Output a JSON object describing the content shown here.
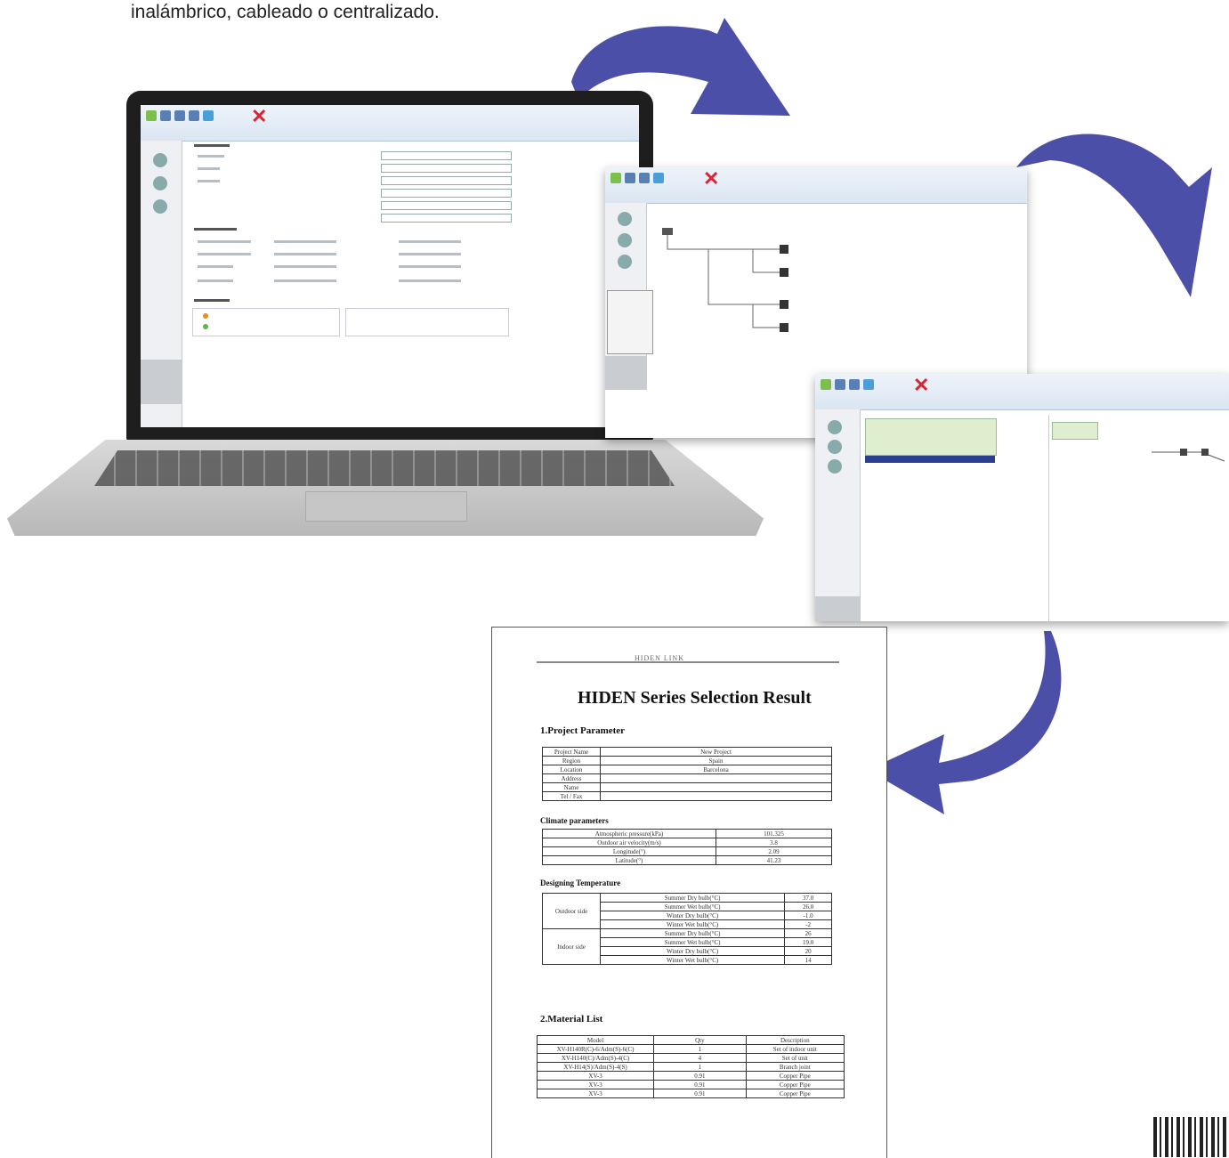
{
  "intro_text": "inalámbrico, cableado o centralizado.",
  "report": {
    "header": "HIDEN LINK",
    "title": "HIDEN Series Selection Result",
    "section1": "1.Project Parameter",
    "project_rows": [
      [
        "Project Name",
        "New Project"
      ],
      [
        "Region",
        "Spain"
      ],
      [
        "Location",
        "Barcelona"
      ],
      [
        "Address",
        ""
      ],
      [
        "Name",
        ""
      ],
      [
        "Tel / Fax",
        ""
      ]
    ],
    "climate_title": "Climate parameters",
    "climate_rows": [
      [
        "Atmospheric pressure(kPa)",
        "101.325"
      ],
      [
        "Outdoor air velocity(m/s)",
        "3.8"
      ],
      [
        "Longitude(°)",
        "2.09"
      ],
      [
        "Latitude(°)",
        "41.23"
      ]
    ],
    "design_title": "Designing Temperature",
    "design_groups": [
      {
        "side": "Outdoor side",
        "rows": [
          [
            "Summer Dry bulb(°C)",
            "37.0"
          ],
          [
            "Summer Wet bulb(°C)",
            "26.0"
          ],
          [
            "Winter Dry bulb(°C)",
            "-1.0"
          ],
          [
            "Winter Wet bulb(°C)",
            "-2"
          ]
        ]
      },
      {
        "side": "Indoor side",
        "rows": [
          [
            "Summer Dry bulb(°C)",
            "26"
          ],
          [
            "Summer Wet bulb(°C)",
            "19.0"
          ],
          [
            "Winter Dry bulb(°C)",
            "20"
          ],
          [
            "Winter Wet bulb(°C)",
            "14"
          ]
        ]
      }
    ],
    "section2": "2.Material List",
    "material_header": [
      "Model",
      "Qty",
      "Description"
    ],
    "material_rows": [
      [
        "XV-H140R(C)-6/Adm(S)-6(C)",
        "1",
        "Set of indoor unit"
      ],
      [
        "XV-H140(C)/Adm(S)-4(C)",
        "4",
        "Set of unit"
      ],
      [
        "XV-H14(S)/Adm(S)-4(S)",
        "1",
        "Branch joint"
      ],
      [
        "XV-3",
        "0.91",
        "Copper Pipe"
      ],
      [
        "XV-3",
        "0.91",
        "Copper Pipe"
      ],
      [
        "XV-3",
        "0.91",
        "Copper Pipe"
      ]
    ]
  },
  "colors": {
    "arrow": "#4b4fa8",
    "arrow_dark": "#3b3f93"
  },
  "icons": [
    "curved-arrow-icon",
    "close-x-icon",
    "qr-code-icon"
  ]
}
